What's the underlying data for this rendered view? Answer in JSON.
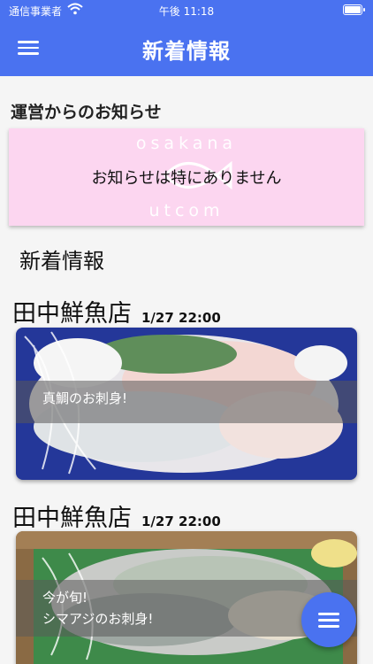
{
  "status_bar": {
    "carrier": "通信事業者",
    "time": "午後 11:18",
    "wifi_icon": "wifi-icon",
    "battery_icon": "battery-icon"
  },
  "header": {
    "title": "新着情報",
    "menu_icon": "hamburger-menu-icon"
  },
  "notice": {
    "heading": "運営からのお知らせ",
    "watermark_top": "osakana",
    "watermark_bottom": "utcom",
    "message": "お知らせは特にありません"
  },
  "news": {
    "heading": "新着情報",
    "posts": [
      {
        "shop": "田中鮮魚店",
        "date": "1/27 22:00",
        "caption": [
          "真鯛のお刺身!"
        ]
      },
      {
        "shop": "田中鮮魚店",
        "date": "1/27 22:00",
        "caption": [
          "今が旬!",
          "シマアジのお刺身!"
        ]
      }
    ]
  },
  "fab": {
    "icon": "menu-lines-icon"
  },
  "colors": {
    "accent": "#4a72f0",
    "notice_bg": "#fcd6f0",
    "page_bg": "#f5f5f5"
  }
}
